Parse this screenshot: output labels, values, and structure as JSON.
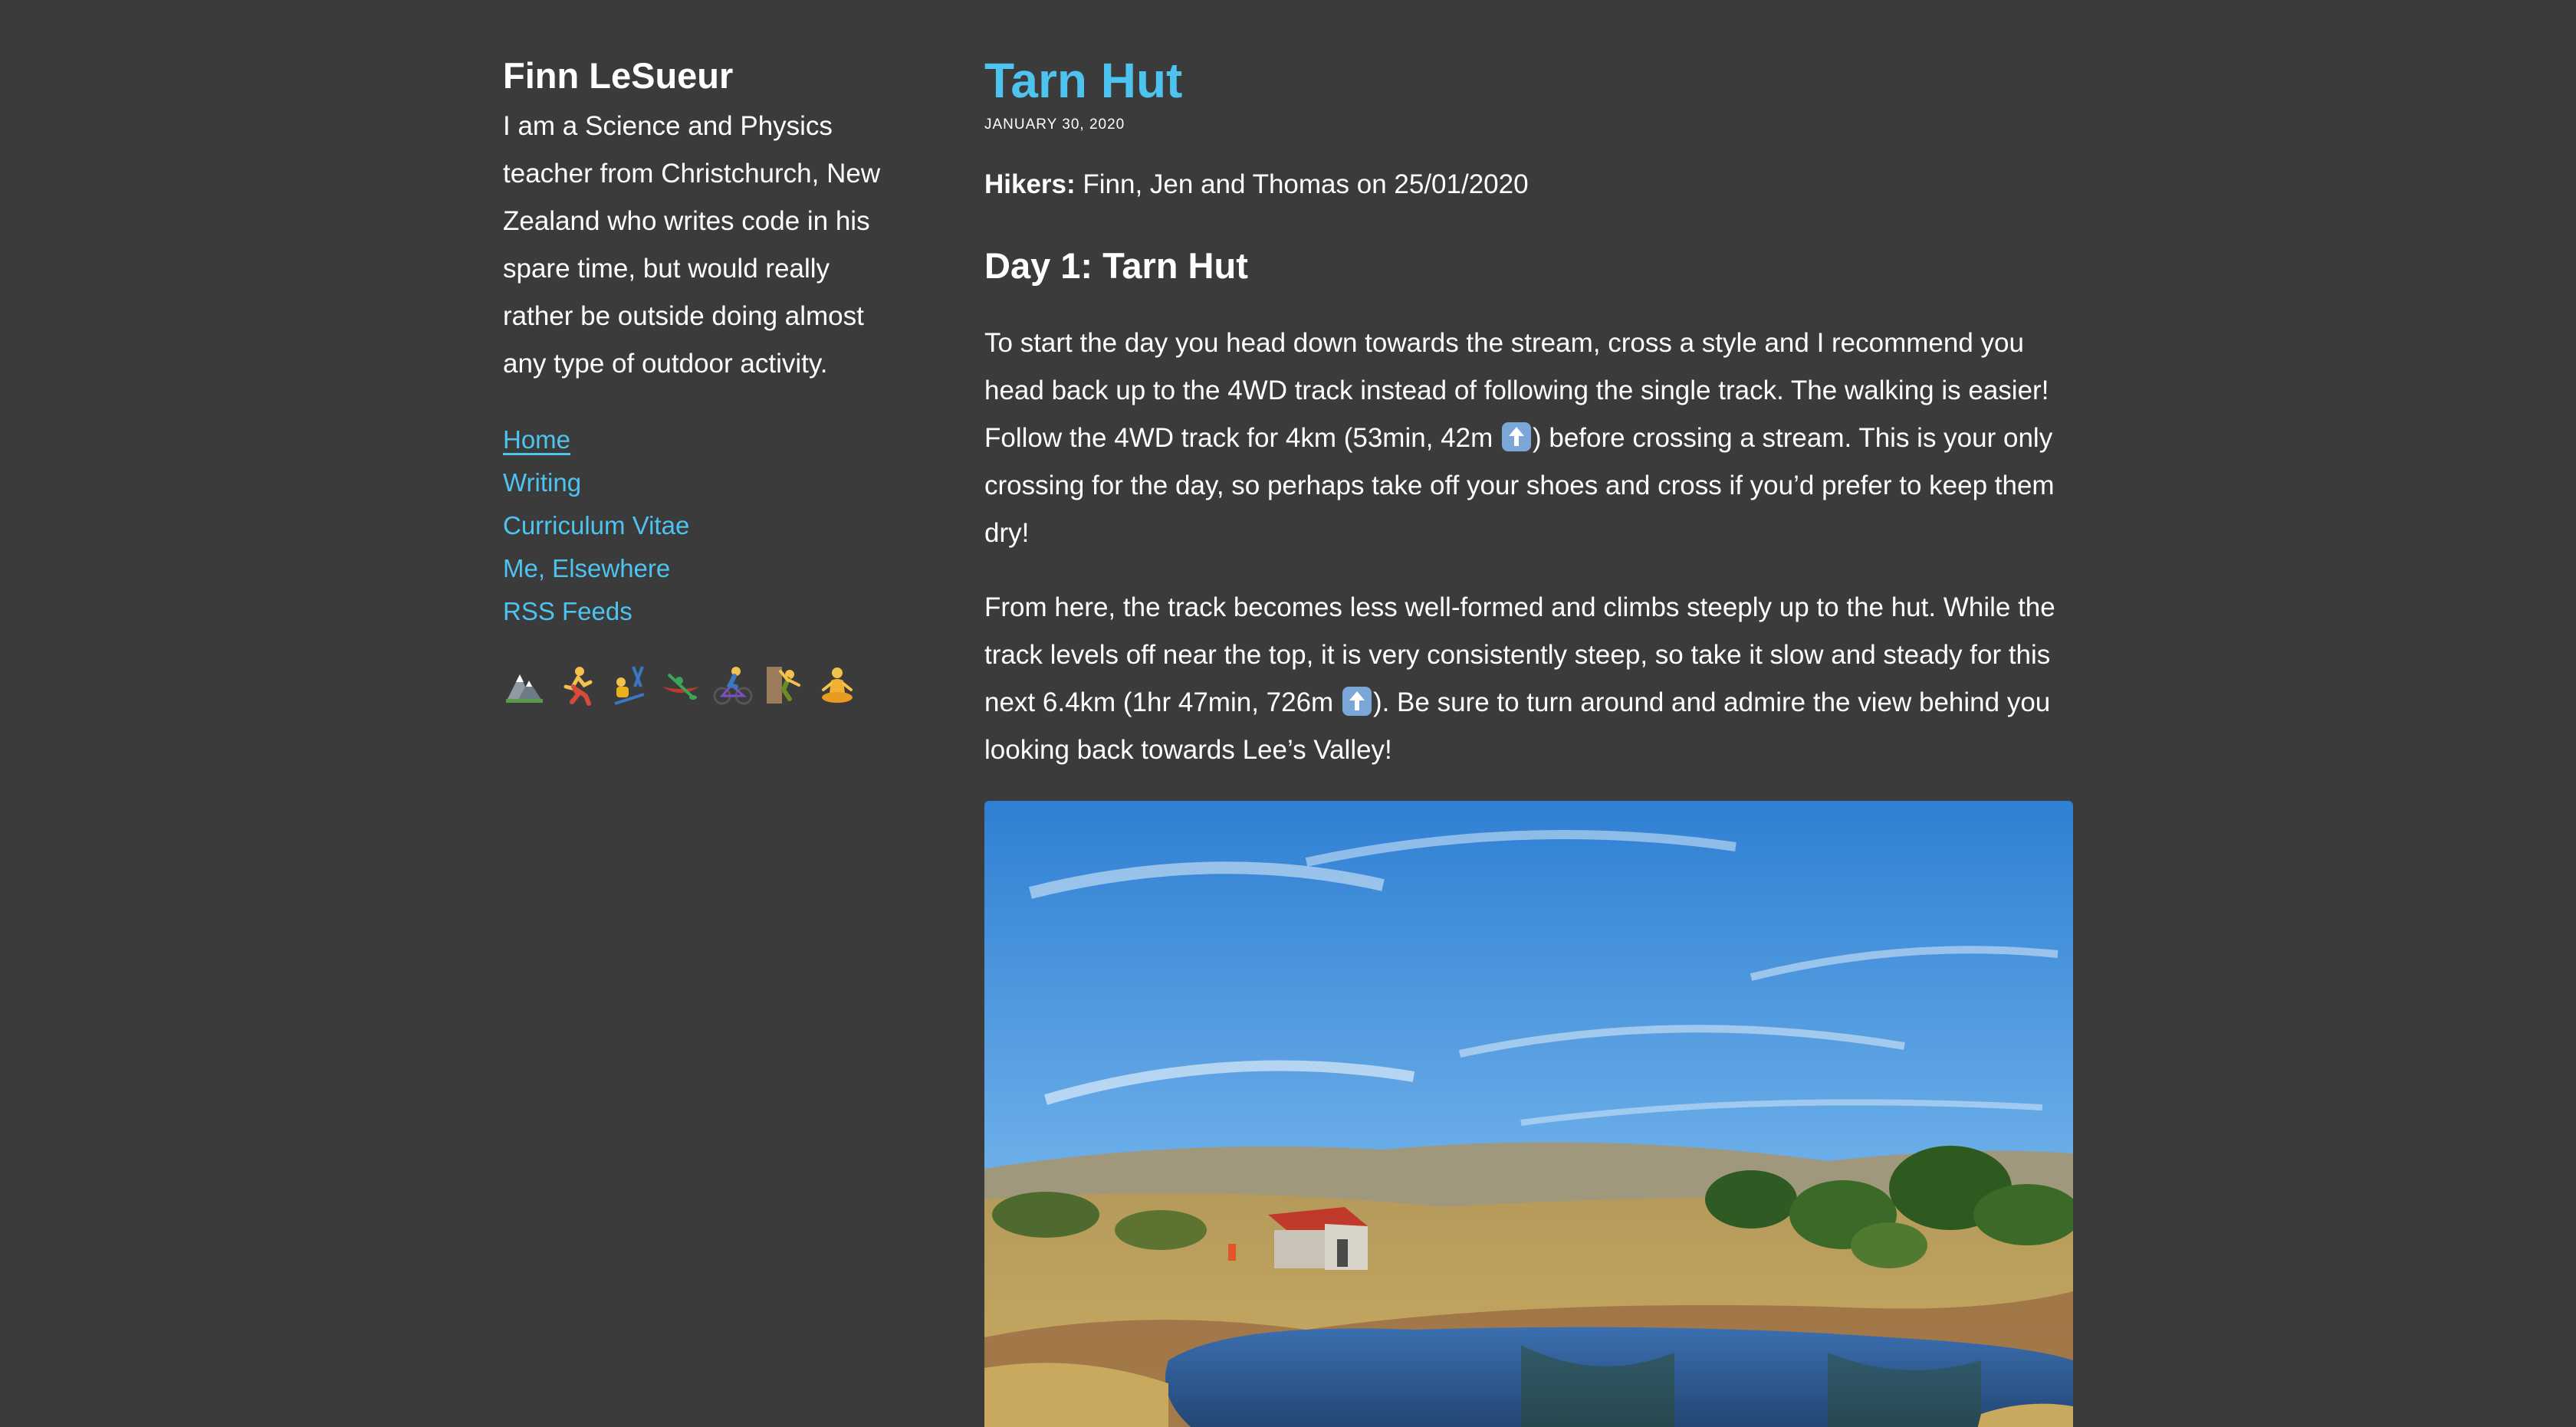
{
  "sidebar": {
    "site_title": "Finn LeSueur",
    "bio": "I am a Science and Physics teacher from Christchurch, New Zealand who writes code in his spare time, but would really rather be outside doing almost any type of outdoor activity.",
    "nav": [
      {
        "label": "Home",
        "active": true
      },
      {
        "label": "Writing"
      },
      {
        "label": "Curriculum Vitae"
      },
      {
        "label": "Me, Elsewhere"
      },
      {
        "label": "RSS Feeds"
      }
    ],
    "activities": [
      "mountain-icon",
      "runner-icon",
      "skier-icon",
      "canoe-icon",
      "cyclist-icon",
      "climber-icon",
      "meditation-icon"
    ]
  },
  "post": {
    "title": "Tarn Hut",
    "date": "January 30, 2020",
    "hikers_label": "Hikers:",
    "hikers_value": " Finn, Jen and Thomas on 25/01/2020",
    "day_heading": "Day 1: Tarn Hut",
    "para1_a": "To start the day you head down towards the stream, cross a style and I recommend you head back up to the 4WD track instead of following the single track. The walking is easier! Follow the 4WD track for 4km (53min, 42m ",
    "para1_b": ") before crossing a stream. This is your only crossing for the day, so perhaps take off your shoes and cross if you’d prefer to keep them dry!",
    "para2_a": "From here, the track becomes less well-formed and climbs steeply up to the hut. While the track levels off near the top, it is very consistently steep, so take it slow and steady for this next 6.4km (1hr 47min, 726m ",
    "para2_b": "). Be sure to turn around and admire the view behind you looking back towards Lee’s Valley!"
  },
  "colors": {
    "background": "#3b3b3b",
    "accent": "#4dc3f0",
    "text": "#ffffff"
  }
}
